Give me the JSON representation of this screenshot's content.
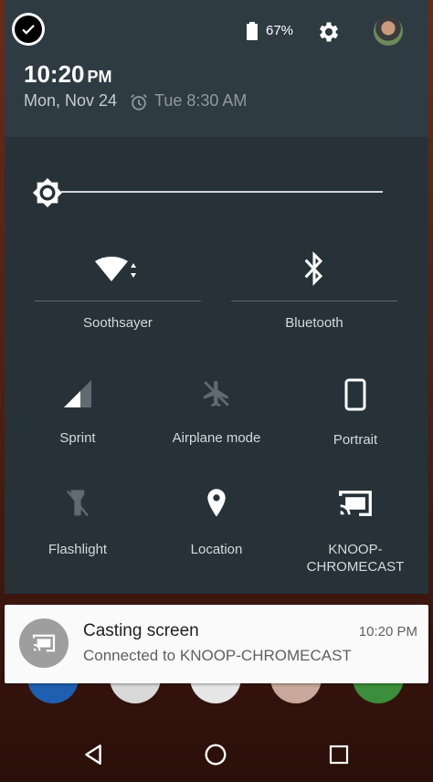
{
  "status_bar": {
    "battery": "67%"
  },
  "header": {
    "time": "10:20",
    "ampm": "PM",
    "date": "Mon, Nov 24",
    "alarm": "Tue 8:30 AM"
  },
  "quick_settings": {
    "brightness_level": 0.0,
    "tiles": {
      "wifi": "Soothsayer",
      "bluetooth": "Bluetooth",
      "sprint": "Sprint",
      "airplane": "Airplane mode",
      "portrait": "Portrait",
      "flashlight": "Flashlight",
      "location": "Location",
      "cast_line1": "KNOOP-",
      "cast_line2": "CHROMECAST"
    }
  },
  "notification": {
    "title": "Casting screen",
    "text": "Connected to KNOOP-CHROMECAST",
    "time": "10:20 PM"
  },
  "colors": {
    "header_bg": "#2f3b43",
    "panel_bg": "#263238",
    "notification_bg": "#fafafa"
  },
  "icons": [
    "check-circle-icon",
    "battery-icon",
    "gear-icon",
    "avatar",
    "alarm-icon",
    "brightness-icon",
    "wifi-icon",
    "bluetooth-icon",
    "signal-icon",
    "airplane-icon",
    "phone-portrait-icon",
    "flashlight-icon",
    "location-pin-icon",
    "cast-icon",
    "back-icon",
    "home-icon",
    "recents-icon"
  ]
}
